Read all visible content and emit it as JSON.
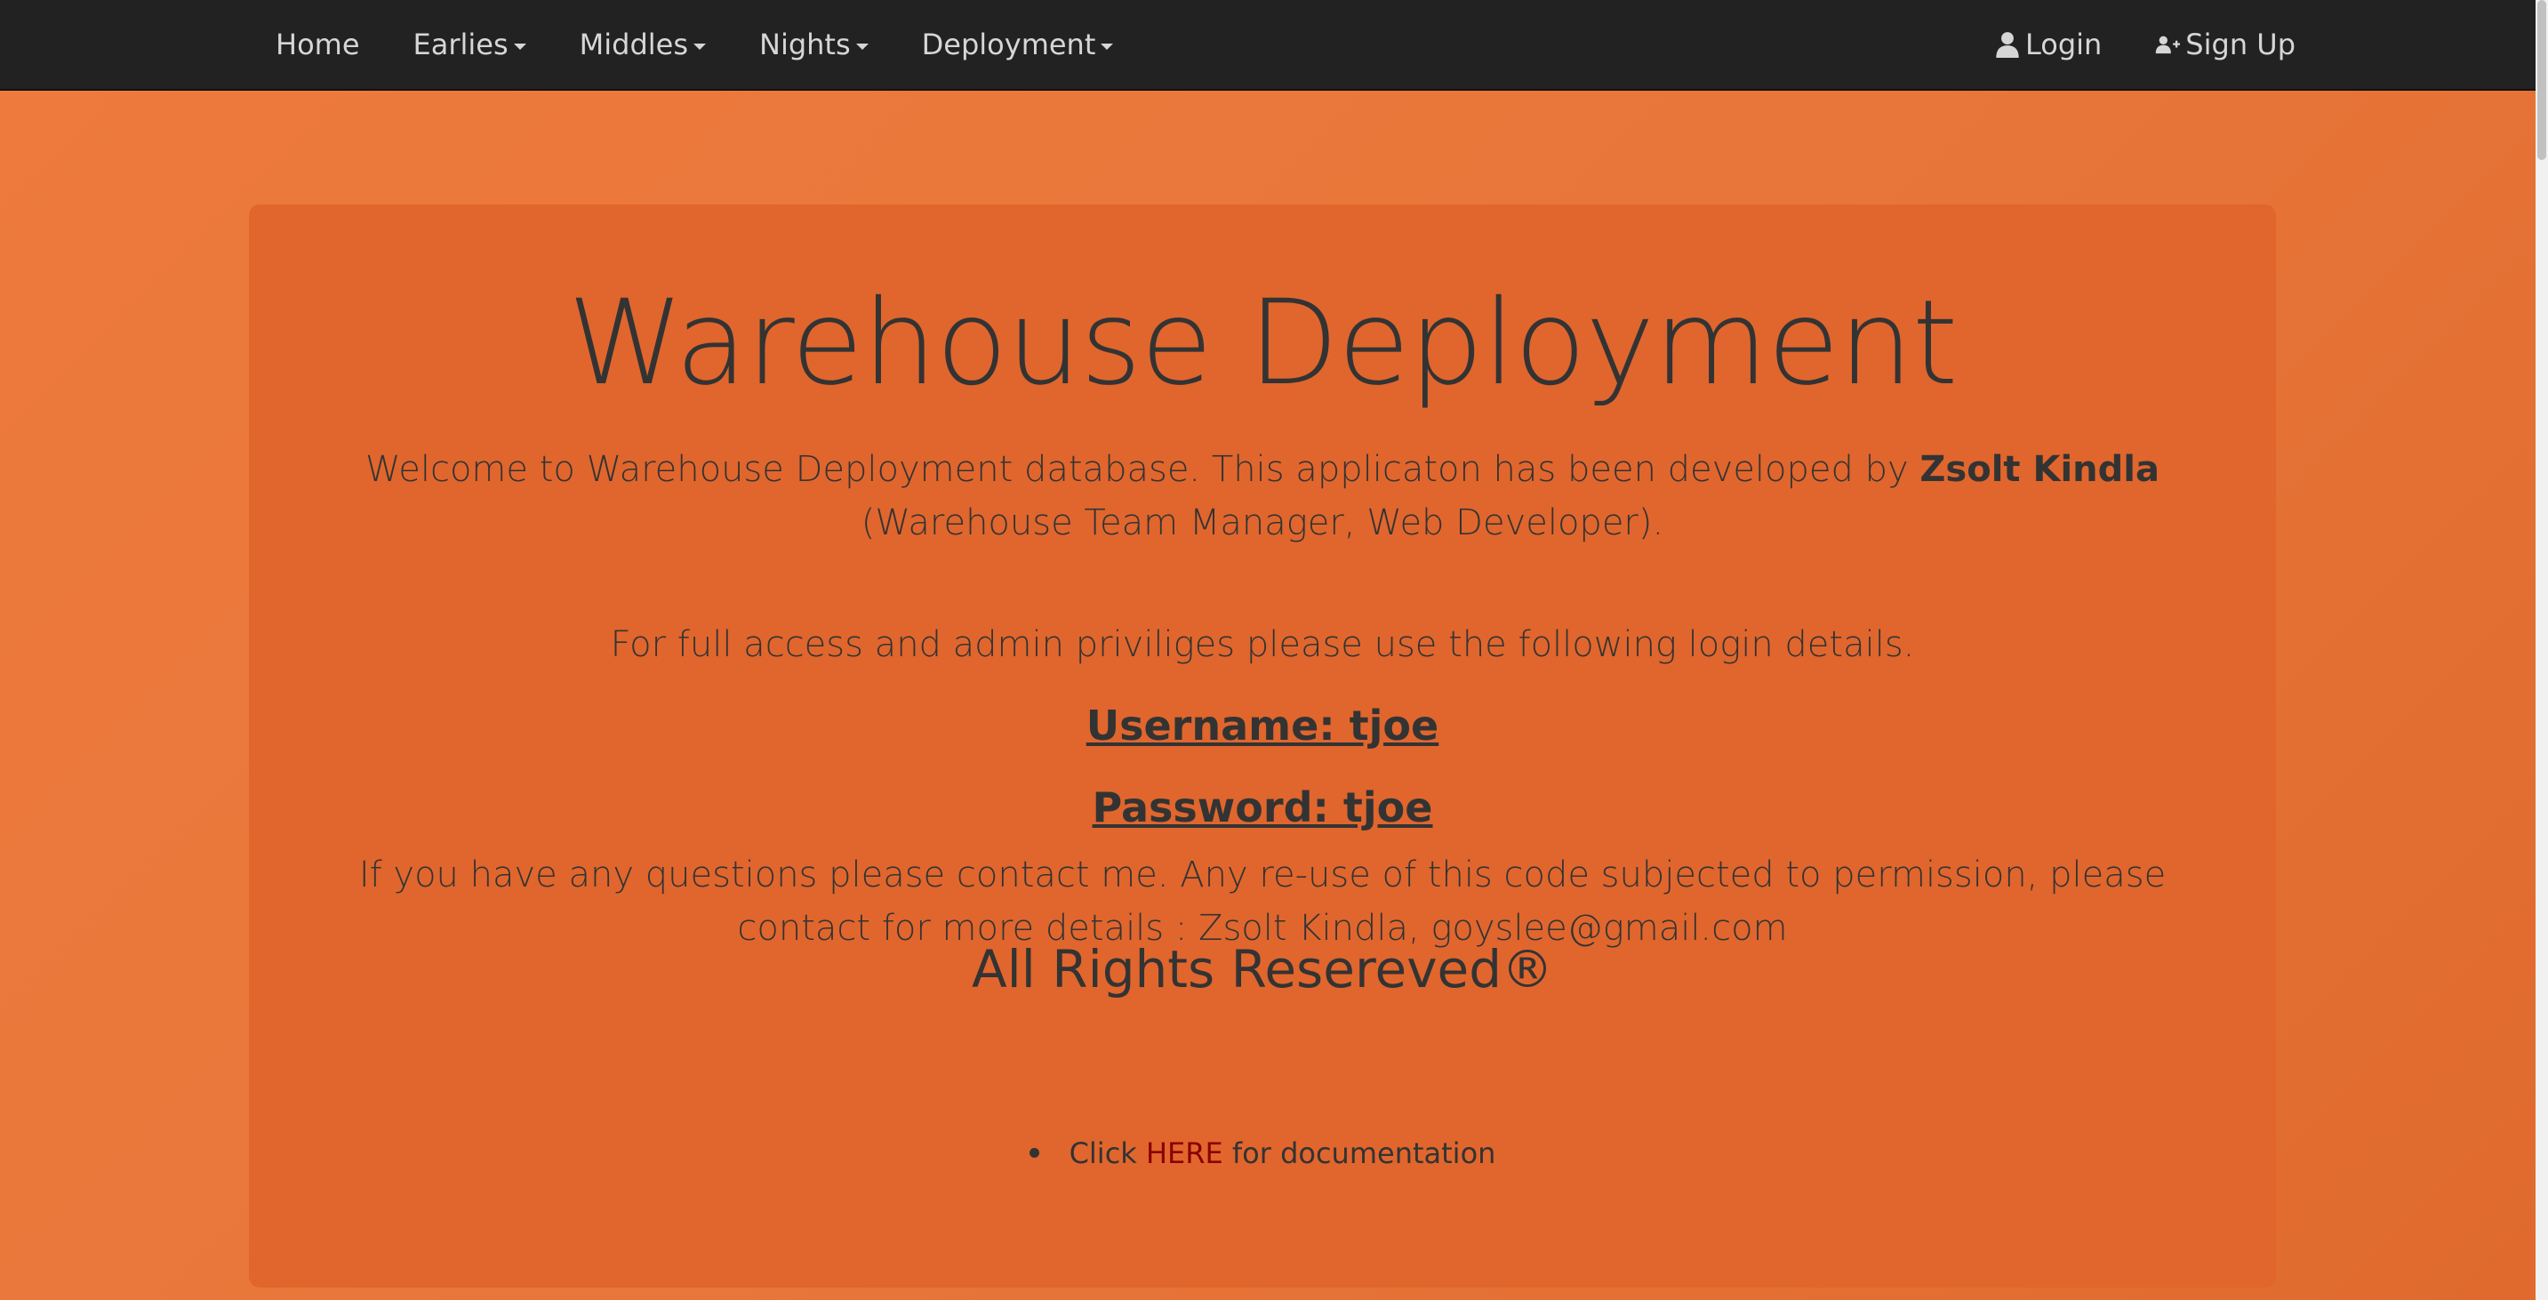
{
  "navbar": {
    "left_items": [
      {
        "label": "Home",
        "dropdown": false
      },
      {
        "label": "Earlies",
        "dropdown": true
      },
      {
        "label": "Middles",
        "dropdown": true
      },
      {
        "label": "Nights",
        "dropdown": true
      },
      {
        "label": "Deployment",
        "dropdown": true
      }
    ],
    "login": {
      "label": "Login",
      "icon": "user-icon"
    },
    "signup": {
      "label": "Sign Up",
      "icon": "user-plus-icon"
    }
  },
  "main": {
    "title": "Warehouse Deployment",
    "welcome_before": "Welcome to Warehouse Deployment database. This applicaton has been developed by ",
    "welcome_author": "Zsolt Kindla",
    "welcome_after": " (Warehouse Team Manager, Web Developer).",
    "access_text": "For full access and admin priviliges please use the following login details.",
    "username_line": "Username: tjoe",
    "password_line": "Password: tjoe",
    "contact_text": "If you have any questions please contact me. Any re-use of this code subjected to permission, please contact for more details : Zsolt Kindla, goyslee@gmail.com",
    "rights_text": "All Rights Resereved®",
    "doc_before": "Click ",
    "doc_link": "HERE",
    "doc_after": " for documentation"
  },
  "colors": {
    "navbar_bg": "#222222",
    "page_bg": "#ee7a3d",
    "panel_bg": "#e0662d",
    "text": "#333333",
    "link": "#8b0000"
  }
}
